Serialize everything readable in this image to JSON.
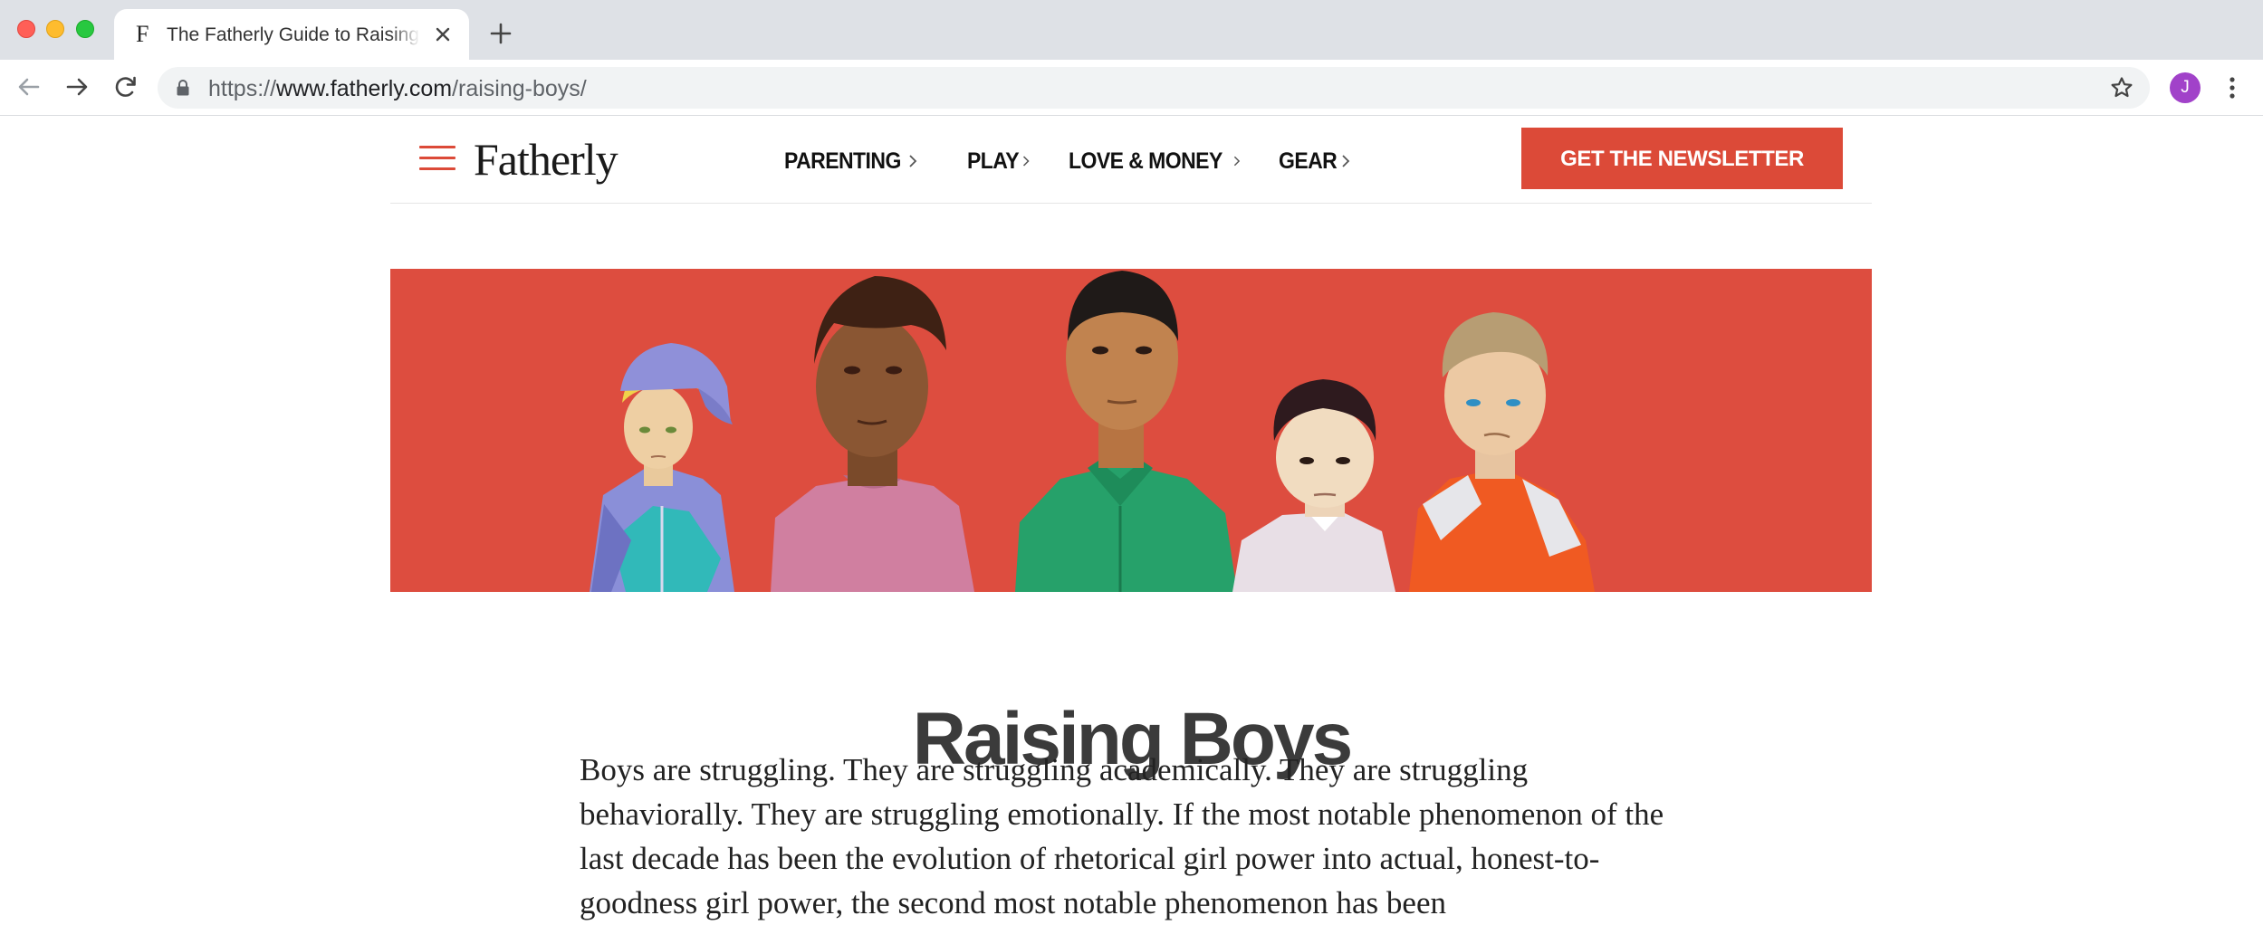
{
  "browser": {
    "tab": {
      "favicon": "F",
      "title": "The Fatherly Guide to Raising Boys"
    },
    "url": {
      "scheme": "https://",
      "host": "www.fatherly.com",
      "path": "/raising-boys/"
    },
    "profile_initial": "J",
    "icons": [
      "back-icon",
      "forward-icon",
      "reload-icon",
      "lock-icon",
      "star-icon",
      "menu-kebab-icon",
      "close-icon",
      "plus-icon"
    ]
  },
  "site": {
    "logo": "Fatherly",
    "nav": [
      {
        "label": "PARENTING"
      },
      {
        "label": "PLAY"
      },
      {
        "label": "LOVE & MONEY"
      },
      {
        "label": "GEAR"
      }
    ],
    "cta": "GET THE NEWSLETTER",
    "accent_color": "#dc4a38"
  },
  "article": {
    "title": "Raising Boys",
    "intro": "Boys are struggling. They are struggling academically. They are struggling behaviorally. They are struggling emotionally. If the most notable phenomenon of the last decade has been the evolution of rhetorical girl power into actual, honest-to-goodness girl power, the second most notable phenomenon has been"
  }
}
